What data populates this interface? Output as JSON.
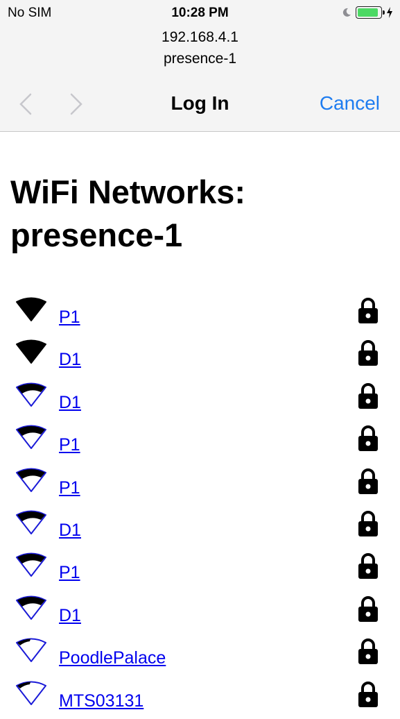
{
  "status_bar": {
    "carrier": "No SIM",
    "time": "10:28 PM",
    "battery_color": "#4cd964",
    "battery_level": 0.95,
    "icons": [
      "moon-icon",
      "battery-icon",
      "charging-bolt-icon"
    ]
  },
  "browser": {
    "host": "192.168.4.1",
    "page_name": "presence-1",
    "title": "Log In",
    "cancel_label": "Cancel",
    "accent_color": "#1e7cf0",
    "nav_icons": [
      "back-chevron-icon",
      "forward-chevron-icon"
    ]
  },
  "page": {
    "heading": "WiFi Networks: presence-1",
    "networks": [
      {
        "ssid": "P1",
        "signal": "full",
        "secured": true
      },
      {
        "ssid": "D1",
        "signal": "full",
        "secured": true
      },
      {
        "ssid": "D1",
        "signal": "high",
        "secured": true
      },
      {
        "ssid": "P1",
        "signal": "high",
        "secured": true
      },
      {
        "ssid": "P1",
        "signal": "high",
        "secured": true
      },
      {
        "ssid": "D1",
        "signal": "high",
        "secured": true
      },
      {
        "ssid": "P1",
        "signal": "high",
        "secured": true
      },
      {
        "ssid": "D1",
        "signal": "high",
        "secured": true
      },
      {
        "ssid": "PoodlePalace",
        "signal": "low",
        "secured": true
      },
      {
        "ssid": "MTS03131",
        "signal": "low",
        "secured": true
      }
    ],
    "link_color": "#0000ee"
  }
}
